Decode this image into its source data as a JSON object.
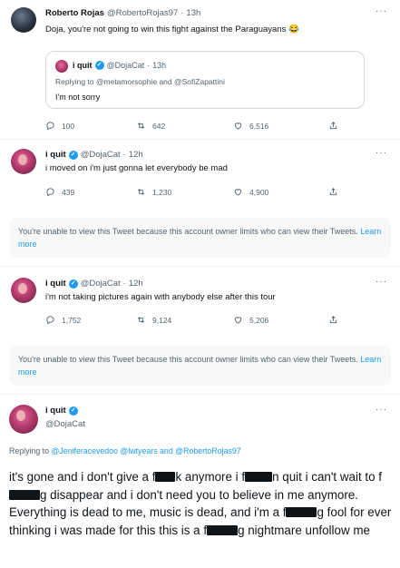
{
  "tweets": [
    {
      "name": "Roberto Rojas",
      "handle": "@RobertoRojas97",
      "time": "13h",
      "text": "Doja, you're not going to win this fight against the Paraguayans 😂",
      "quote": {
        "name": "i quit",
        "handle": "@DojaCat",
        "time": "13h",
        "replying": "Replying to @metamorsophie and @SofiZapattini",
        "text": "I'm not sorry"
      },
      "replies": "100",
      "retweets": "642",
      "likes": "6,516"
    },
    {
      "name": "i quit",
      "handle": "@DojaCat",
      "time": "12h",
      "text": "i moved on i'm just gonna let everybody be mad",
      "replies": "439",
      "retweets": "1,230",
      "likes": "4,900"
    },
    {
      "name": "i quit",
      "handle": "@DojaCat",
      "time": "12h",
      "text": "i'm not taking pictures again with anybody else after this tour",
      "replies": "1,752",
      "retweets": "9,124",
      "likes": "5,206"
    }
  ],
  "notice": {
    "text": "You're unable to view this Tweet because this account owner limits who can view their Tweets.",
    "link": "Learn more"
  },
  "main_tweet": {
    "name": "i quit",
    "handle": "@DojaCat",
    "replying_prefix": "Replying to",
    "replying_mentions": "@Jeniferacevedoo @lwtyears and @RobertoRojas97",
    "segments": [
      "it's gone and i don't give a f",
      "k anymore i f",
      "n quit i can't wait to f",
      "g disappear and i don't need you to believe in me anymore. Everything is dead to me, music is dead, and i'm a f",
      "g fool for ever thinking i was made for this this is a f",
      "g nightmare unfollow me"
    ]
  },
  "icons": {
    "reply": "reply-icon",
    "retweet": "retweet-icon",
    "like": "like-icon",
    "share": "share-icon",
    "verified": "verified-icon",
    "more": "more-icon"
  },
  "colors": {
    "accent": "#1d9bf0",
    "secondary_text": "#536471"
  }
}
